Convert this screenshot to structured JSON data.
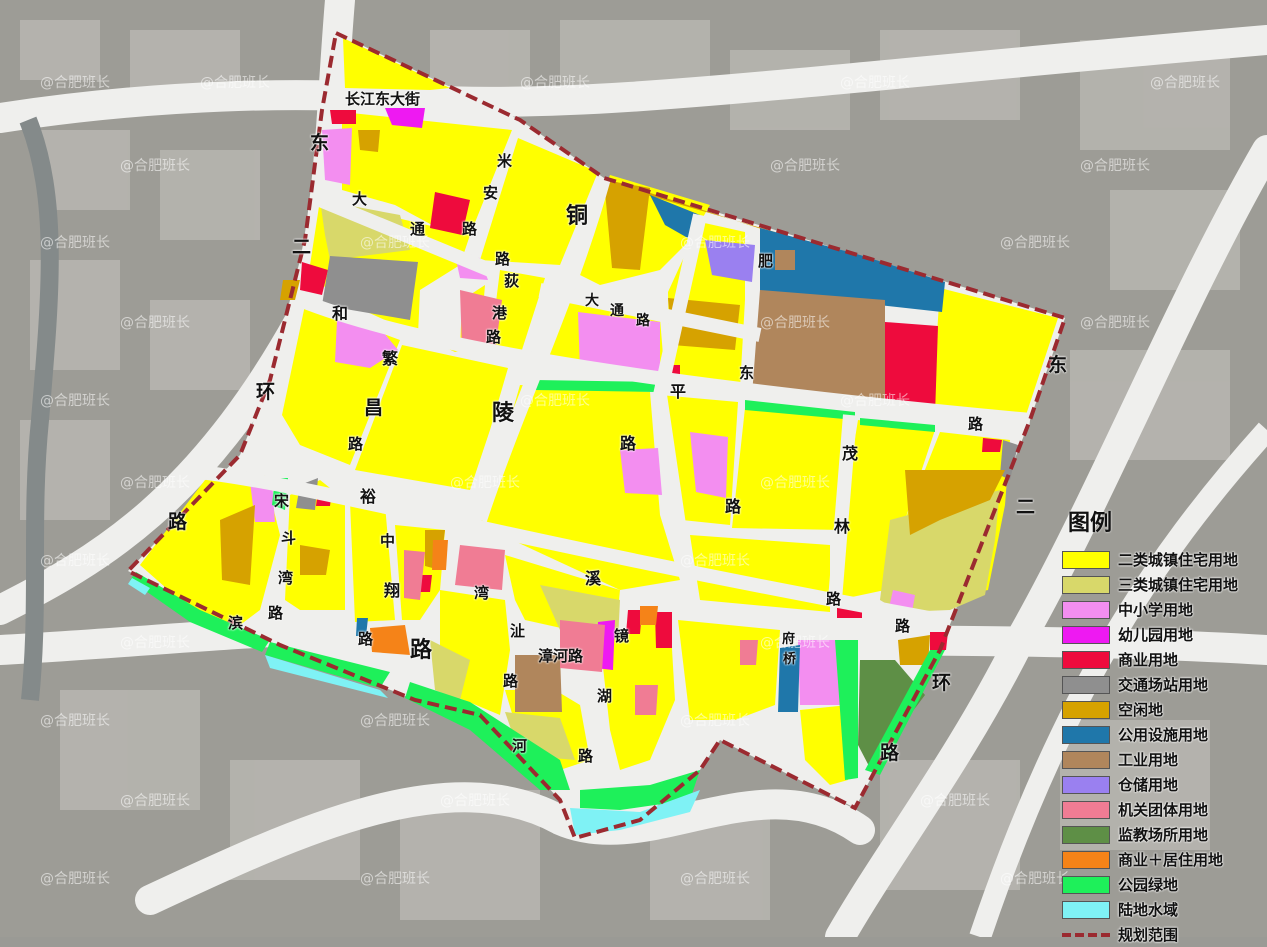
{
  "colors": {
    "residential2": "#ffff00",
    "residential3": "#d8d86a",
    "school": "#f38ef0",
    "kindergarten": "#ee19f2",
    "commercial": "#ee0b3d",
    "transport": "#8f8f8f",
    "vacant": "#d6a200",
    "utility": "#1f77aa",
    "industrial": "#b0865c",
    "storage": "#9a80f0",
    "government": "#f07c94",
    "prison": "#5e8f46",
    "mixed": "#f58318",
    "park": "#1ef05a",
    "water": "#7ff2f5",
    "boundary": "#9b2a30"
  },
  "road_labels": [
    "长江东大街",
    "东",
    "二",
    "环",
    "路",
    "东",
    "二",
    "环",
    "路",
    "大",
    "通",
    "路",
    "和",
    "平",
    "路",
    "繁",
    "昌",
    "路",
    "铜",
    "陵",
    "路",
    "米",
    "安",
    "路",
    "荻",
    "港",
    "路",
    "裕",
    "溪",
    "路",
    "茂",
    "林",
    "路",
    "宋",
    "斗",
    "湾",
    "路",
    "中",
    "翔",
    "路",
    "湾",
    "沚",
    "路",
    "滨",
    "河",
    "路",
    "镜",
    "湖",
    "路",
    "肥",
    "东",
    "路",
    "大",
    "通",
    "路",
    "漳河路",
    "府",
    "桥"
  ],
  "watermark": "@合肥班长",
  "legend": {
    "title": "图例",
    "items": [
      {
        "label": "二类城镇住宅用地",
        "color": "#ffff00"
      },
      {
        "label": "三类城镇住宅用地",
        "color": "#d8d86a"
      },
      {
        "label": "中小学用地",
        "color": "#f38ef0"
      },
      {
        "label": "幼儿园用地",
        "color": "#ee19f2"
      },
      {
        "label": "商业用地",
        "color": "#ee0b3d"
      },
      {
        "label": "交通场站用地",
        "color": "#8f8f8f"
      },
      {
        "label": "空闲地",
        "color": "#d6a200"
      },
      {
        "label": "公用设施用地",
        "color": "#1f77aa"
      },
      {
        "label": "工业用地",
        "color": "#b0865c"
      },
      {
        "label": "仓储用地",
        "color": "#9a80f0"
      },
      {
        "label": "机关团体用地",
        "color": "#f07c94"
      },
      {
        "label": "监教场所用地",
        "color": "#5e8f46"
      },
      {
        "label": "商业＋居住用地",
        "color": "#f58318"
      },
      {
        "label": "公园绿地",
        "color": "#1ef05a"
      },
      {
        "label": "陆地水域",
        "color": "#7ff2f5"
      },
      {
        "label": "规划范围",
        "color": "#9b2a30",
        "dashed": true
      }
    ]
  }
}
